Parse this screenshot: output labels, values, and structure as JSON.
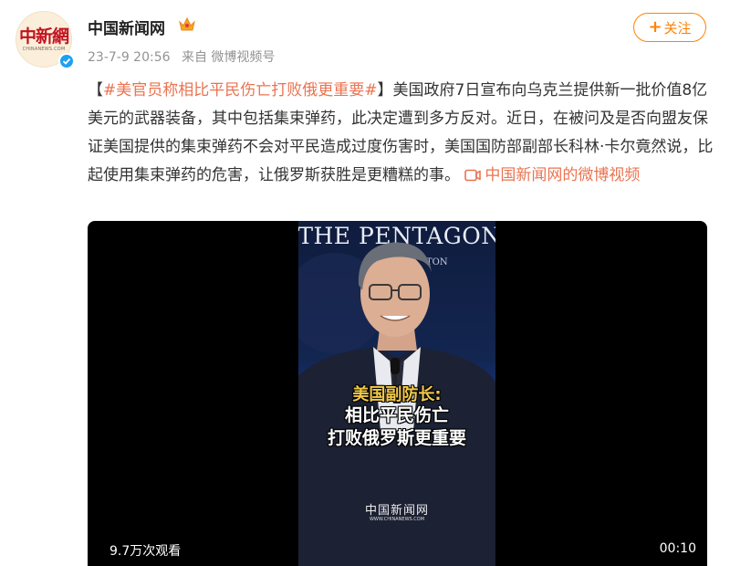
{
  "account": {
    "name": "中国新闻网",
    "avatar_text": "中新網",
    "avatar_subtext": "CHINANEWS.COM",
    "verified_icon": "verified-badge-icon",
    "badge_icon": "crown-icon"
  },
  "meta": {
    "date": "23-7-9 20:56",
    "source": "来自 微博视频号"
  },
  "follow_button": {
    "label": "关注",
    "icon": "plus-icon"
  },
  "post": {
    "open_bracket": "【",
    "topic": "#美官员称相比平民伤亡打败俄更重要#",
    "close_bracket": "】",
    "body": "美国政府7日宣布向乌克兰提供新一批价值8亿美元的武器装备，其中包括集束弹药，此决定遭到多方反对。近日，在被问及是否向盟友保证美国提供的集束弹药不会对平民造成过度伤害时，美国国防部副部长科林·卡尔竟然说，比起使用集束弹药的危害，让俄罗斯获胜是更糟糕的事。",
    "video_link": "中国新闻网的微博视频",
    "video_link_icon": "video-icon"
  },
  "video": {
    "backdrop_text": "THE PENTAGON",
    "backdrop_subtext": "TON",
    "caption_line1": "美国副防长:",
    "caption_line2": "相比平民伤亡",
    "caption_line3": "打败俄罗斯更重要",
    "watermark": "中国新闻网",
    "watermark_en": "WWW.CHINANEWS.COM",
    "views": "9.7万次观看",
    "duration": "00:10"
  },
  "colors": {
    "accent": "#ff8200",
    "link": "#eb7350",
    "verified": "#1da1f2"
  }
}
